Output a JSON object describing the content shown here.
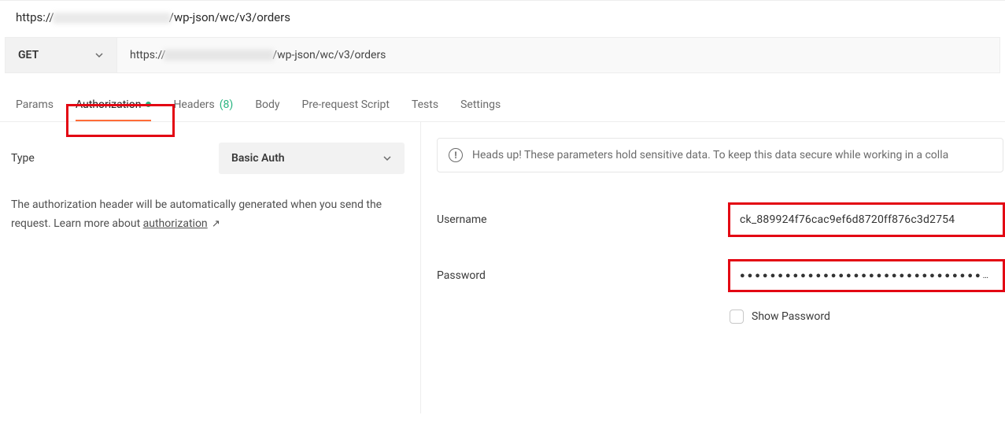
{
  "header": {
    "url_prefix": "https://",
    "url_suffix": "/wp-json/wc/v3/orders"
  },
  "request": {
    "method": "GET",
    "url_prefix": "https://",
    "url_suffix": "/wp-json/wc/v3/orders"
  },
  "tabs": {
    "params": "Params",
    "authorization": "Authorization",
    "headers": "Headers",
    "headers_count": "(8)",
    "body": "Body",
    "prerequest": "Pre-request Script",
    "tests": "Tests",
    "settings": "Settings"
  },
  "auth": {
    "type_label": "Type",
    "type_value": "Basic Auth",
    "help_text_1": "The authorization header will be automatically generated when you send the request. Learn more about ",
    "help_link_text": "authorization",
    "alert_text": "Heads up! These parameters hold sensitive data. To keep this data secure while working in a colla",
    "username_label": "Username",
    "username_value": "ck_889924f76cac9ef6d8720ff876c3d2754",
    "password_label": "Password",
    "password_display": "●●●●●●●●●●●●●●●●●●●●●●●●●●●●●●●●●●●●●",
    "show_password_label": "Show Password"
  }
}
